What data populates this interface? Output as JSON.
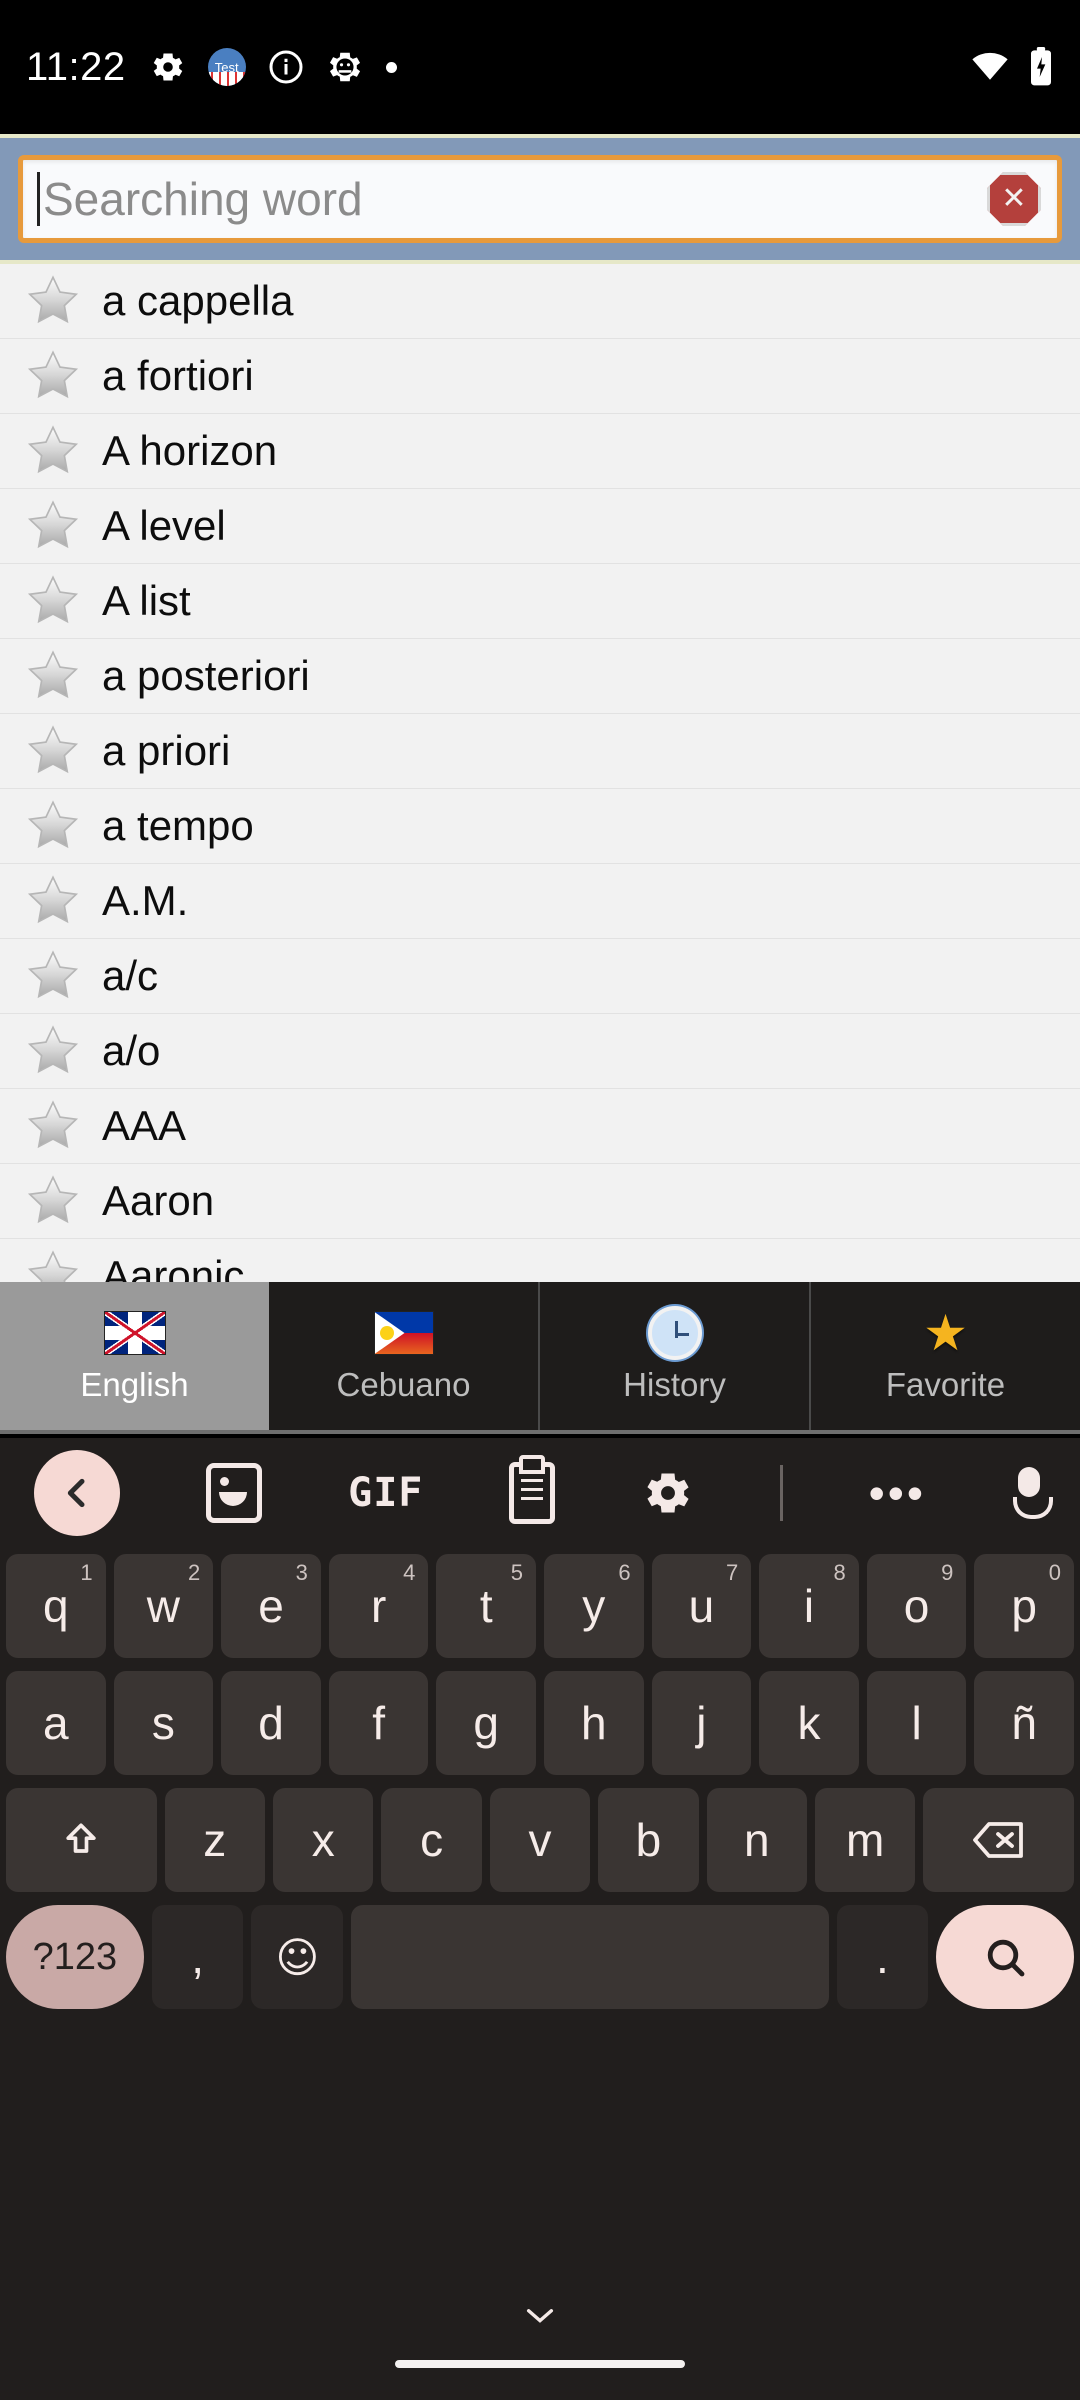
{
  "status_bar": {
    "clock": "11:22",
    "left_icons": [
      "gear-icon",
      "test-app-icon",
      "info-icon",
      "android-gear-icon",
      "dot-icon"
    ],
    "test_app_label": "Test",
    "right_icons": [
      "wifi-icon",
      "battery-charging-icon"
    ]
  },
  "search": {
    "placeholder": "Searching word",
    "value": "",
    "clear_icon": "clear-octagon-icon",
    "frame_color": "#8299b8",
    "border_color": "#e79a3c"
  },
  "word_list": {
    "items": [
      {
        "word": "a cappella",
        "favorite": false
      },
      {
        "word": "a fortiori",
        "favorite": false
      },
      {
        "word": "A horizon",
        "favorite": false
      },
      {
        "word": "A level",
        "favorite": false
      },
      {
        "word": "A list",
        "favorite": false
      },
      {
        "word": "a posteriori",
        "favorite": false
      },
      {
        "word": "a priori",
        "favorite": false
      },
      {
        "word": "a tempo",
        "favorite": false
      },
      {
        "word": "A.M.",
        "favorite": false
      },
      {
        "word": "a/c",
        "favorite": false
      },
      {
        "word": "a/o",
        "favorite": false
      },
      {
        "word": "AAA",
        "favorite": false
      },
      {
        "word": "Aaron",
        "favorite": false
      },
      {
        "word": "Aaronic",
        "favorite": false
      }
    ]
  },
  "tabs": [
    {
      "label": "English",
      "icon": "uk-flag-icon",
      "active": true
    },
    {
      "label": "Cebuano",
      "icon": "philippines-flag-icon",
      "active": false
    },
    {
      "label": "History",
      "icon": "clock-icon",
      "active": false
    },
    {
      "label": "Favorite",
      "icon": "gold-star-icon",
      "active": false
    }
  ],
  "keyboard": {
    "toolbar": [
      {
        "icon": "back-chevron-icon",
        "label": "‹"
      },
      {
        "icon": "sticker-icon",
        "label": ""
      },
      {
        "icon": "gif-icon",
        "label": "GIF"
      },
      {
        "icon": "clipboard-icon",
        "label": ""
      },
      {
        "icon": "gear-icon",
        "label": "⚙"
      },
      {
        "icon": "divider",
        "label": ""
      },
      {
        "icon": "more-options-icon",
        "label": "•••"
      },
      {
        "icon": "microphone-icon",
        "label": ""
      }
    ],
    "row1": [
      {
        "key": "q",
        "sup": "1"
      },
      {
        "key": "w",
        "sup": "2"
      },
      {
        "key": "e",
        "sup": "3"
      },
      {
        "key": "r",
        "sup": "4"
      },
      {
        "key": "t",
        "sup": "5"
      },
      {
        "key": "y",
        "sup": "6"
      },
      {
        "key": "u",
        "sup": "7"
      },
      {
        "key": "i",
        "sup": "8"
      },
      {
        "key": "o",
        "sup": "9"
      },
      {
        "key": "p",
        "sup": "0"
      }
    ],
    "row2": [
      {
        "key": "a"
      },
      {
        "key": "s"
      },
      {
        "key": "d"
      },
      {
        "key": "f"
      },
      {
        "key": "g"
      },
      {
        "key": "h"
      },
      {
        "key": "j"
      },
      {
        "key": "k"
      },
      {
        "key": "l"
      },
      {
        "key": "ñ"
      }
    ],
    "row3": {
      "shift": "⇧",
      "keys": [
        {
          "key": "z"
        },
        {
          "key": "x"
        },
        {
          "key": "c"
        },
        {
          "key": "v"
        },
        {
          "key": "b"
        },
        {
          "key": "n"
        },
        {
          "key": "m"
        }
      ],
      "delete": "⌫"
    },
    "row4": {
      "symbols": "?123",
      "comma": ",",
      "emoji": "☺",
      "space": "",
      "period": ".",
      "search": "⌕"
    }
  },
  "nav_bar": {
    "collapse_icon": "chevron-down-icon",
    "home_pill": "home-indicator"
  }
}
